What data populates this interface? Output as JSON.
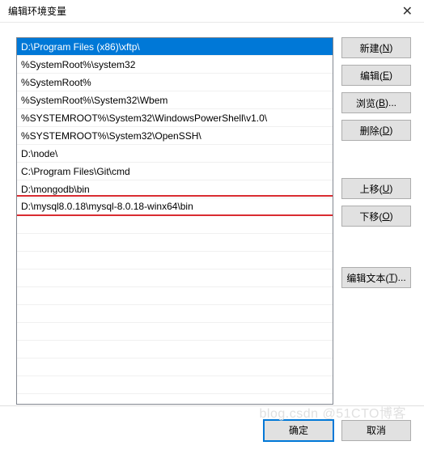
{
  "window": {
    "title": "编辑环境变量"
  },
  "list": {
    "items": [
      "D:\\Program Files (x86)\\xftp\\",
      "%SystemRoot%\\system32",
      "%SystemRoot%",
      "%SystemRoot%\\System32\\Wbem",
      "%SYSTEMROOT%\\System32\\WindowsPowerShell\\v1.0\\",
      "%SYSTEMROOT%\\System32\\OpenSSH\\",
      "D:\\node\\",
      "C:\\Program Files\\Git\\cmd",
      "D:\\mongodb\\bin",
      "D:\\mysql8.0.18\\mysql-8.0.18-winx64\\bin"
    ],
    "selectedIndex": 0,
    "highlightedIndex": 9
  },
  "buttons": {
    "new": {
      "label": "新建(",
      "accel": "N",
      "tail": ")"
    },
    "edit": {
      "label": "编辑(",
      "accel": "E",
      "tail": ")"
    },
    "browse": {
      "label": "浏览(",
      "accel": "B",
      "tail": ")..."
    },
    "delete": {
      "label": "删除(",
      "accel": "D",
      "tail": ")"
    },
    "moveUp": {
      "label": "上移(",
      "accel": "U",
      "tail": ")"
    },
    "moveDown": {
      "label": "下移(",
      "accel": "O",
      "tail": ")"
    },
    "editText": {
      "label": "编辑文本(",
      "accel": "T",
      "tail": ")..."
    }
  },
  "footer": {
    "ok": "确定",
    "cancel": "取消"
  },
  "watermark": "blog.csdn @51CTO博客"
}
